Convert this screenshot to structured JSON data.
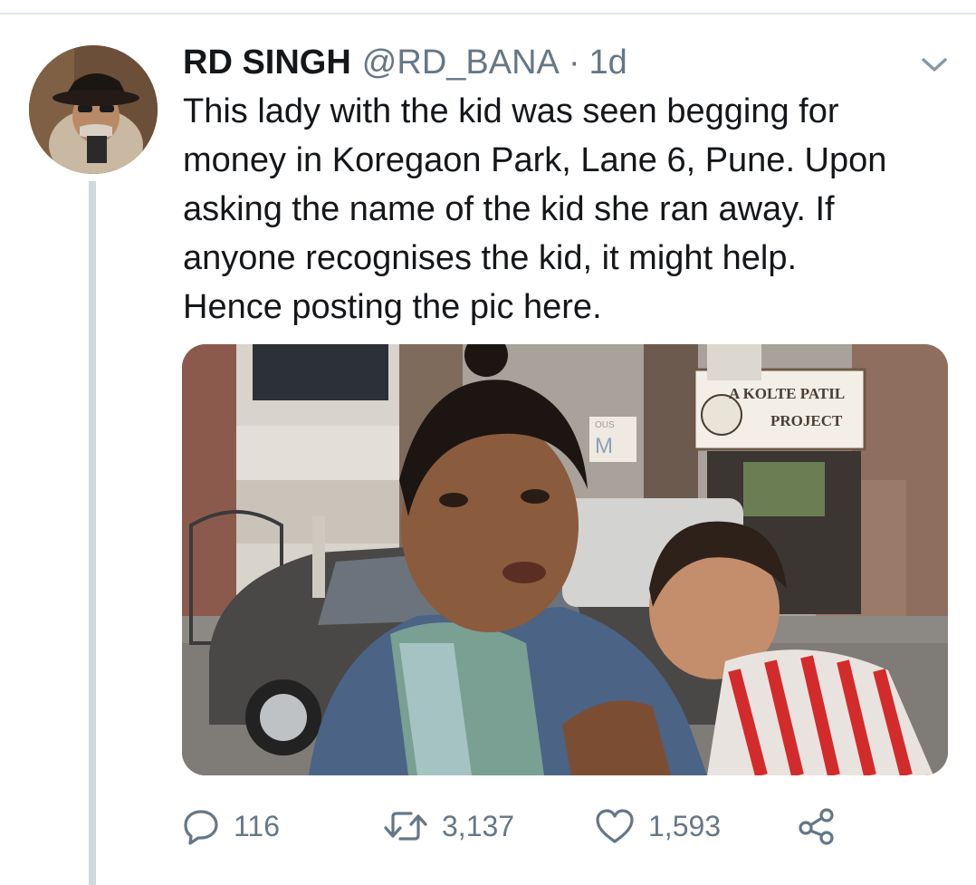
{
  "tweet": {
    "author_name": "RD SINGH",
    "handle": "@RD_BANA",
    "separator": "·",
    "time": "1d",
    "text": "This lady with the kid was seen begging for\nmoney in Koregaon Park, Lane 6, Pune. Upon\nasking the name of the kid she ran away. If\nanyone recognises the kid, it might help.\nHence posting the pic here.",
    "photo_signboard_line1": "A KOLTE PATIL",
    "photo_signboard_line2": "PROJECT",
    "photo_sign_fragment": "OUS",
    "photo_sign_letter": "M"
  },
  "actions": {
    "reply_count": "116",
    "retweet_count": "3,137",
    "like_count": "1,593"
  },
  "icons": {
    "caret": "chevron-down-icon",
    "reply": "reply-icon",
    "retweet": "retweet-icon",
    "like": "heart-icon",
    "share": "share-icon"
  },
  "colors": {
    "text": "#14171a",
    "secondary": "#657786",
    "divider": "#e1e8ed",
    "thread_line": "#cfd9de"
  }
}
